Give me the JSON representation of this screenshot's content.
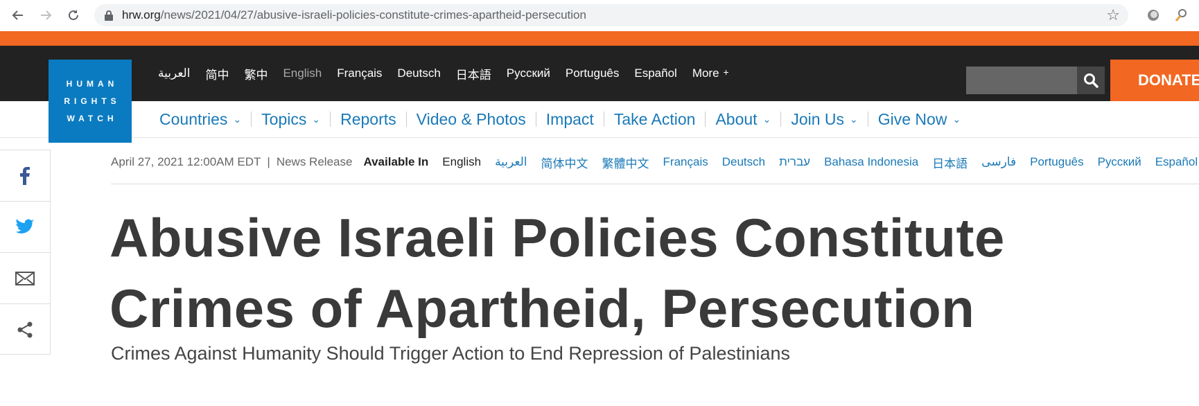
{
  "browser": {
    "url_host": "hrw.org",
    "url_path": "/news/2021/04/27/abusive-israeli-policies-constitute-crimes-apartheid-persecution",
    "icons": [
      "back-icon",
      "forward-icon",
      "reload-icon",
      "lock-icon",
      "star-icon",
      "extension-icon",
      "key-icon"
    ]
  },
  "site": {
    "logo_lines": [
      "HUMAN",
      "RIGHTS",
      "WATCH"
    ],
    "languages": [
      {
        "label": "العربية"
      },
      {
        "label": "简中"
      },
      {
        "label": "繁中"
      },
      {
        "label": "English"
      },
      {
        "label": "Français"
      },
      {
        "label": "Deutsch"
      },
      {
        "label": "日本語"
      },
      {
        "label": "Русский"
      },
      {
        "label": "Português"
      },
      {
        "label": "Español"
      }
    ],
    "more_label": "More",
    "more_plus": "+",
    "donate_label": "DONATE",
    "colors": {
      "orange": "#f26722",
      "dark": "#222222",
      "blue": "#0b7bc1",
      "link": "#1a79b7"
    }
  },
  "section_nav": [
    {
      "label": "Countries",
      "chevron": true
    },
    {
      "label": "Topics",
      "chevron": true
    },
    {
      "label": "Reports",
      "chevron": false
    },
    {
      "label": "Video & Photos",
      "chevron": false
    },
    {
      "label": "Impact",
      "chevron": false
    },
    {
      "label": "Take Action",
      "chevron": false
    },
    {
      "label": "About",
      "chevron": true
    },
    {
      "label": "Join Us",
      "chevron": true
    },
    {
      "label": "Give Now",
      "chevron": true
    }
  ],
  "share_icons": [
    "facebook-icon",
    "twitter-icon",
    "email-icon",
    "share-icon"
  ],
  "article": {
    "date": "April 27, 2021 12:00AM EDT",
    "separator": "|",
    "type": "News Release",
    "available_in_label": "Available In",
    "available_languages": [
      "English",
      "العربية",
      "简体中文",
      "繁體中文",
      "Français",
      "Deutsch",
      "עברית",
      "Bahasa Indonesia",
      "日本語",
      "فارسی",
      "Português",
      "Русский",
      "Español"
    ],
    "title": "Abusive Israeli Policies Constitute Crimes of Apartheid, Persecution",
    "subtitle": "Crimes Against Humanity Should Trigger Action to End Repression of Palestinians"
  }
}
